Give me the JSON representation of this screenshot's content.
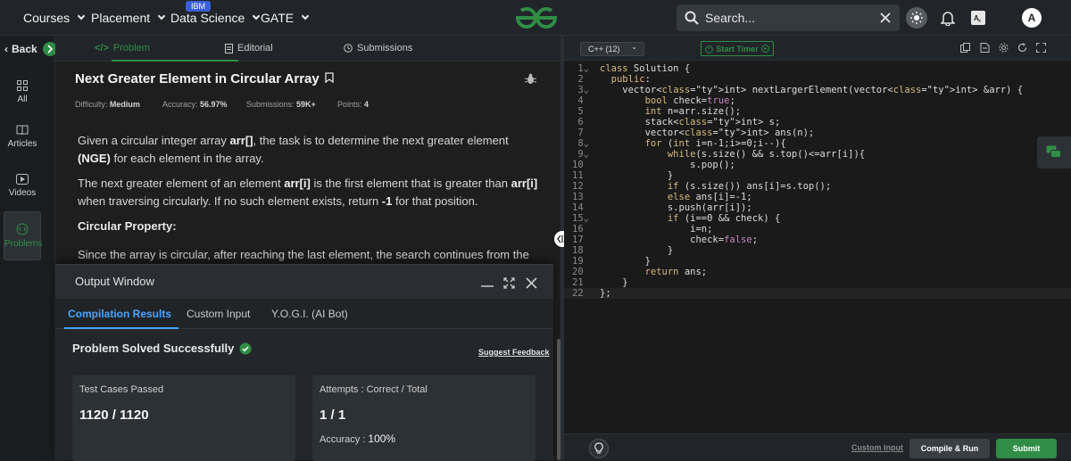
{
  "topnav": {
    "items": [
      {
        "label": "Courses"
      },
      {
        "label": "Placement"
      },
      {
        "label": "Data Science"
      },
      {
        "label": "GATE"
      }
    ],
    "ibm_badge": "IBM",
    "search_placeholder": "Search...",
    "avatar_letter": "A"
  },
  "sidebar": {
    "back_label": "Back",
    "items": [
      {
        "label": "All",
        "icon": "grid-icon"
      },
      {
        "label": "Articles",
        "icon": "book-icon"
      },
      {
        "label": "Videos",
        "icon": "play-icon"
      },
      {
        "label": "Problems",
        "icon": "code-icon"
      }
    ]
  },
  "problem_tabs": [
    {
      "label": "Problem",
      "icon": "code-icon"
    },
    {
      "label": "Editorial",
      "icon": "document-icon"
    },
    {
      "label": "Submissions",
      "icon": "clock-icon"
    }
  ],
  "problem": {
    "title": "Next Greater Element in Circular Array",
    "difficulty_label": "Difficulty:",
    "difficulty_value": "Medium",
    "accuracy_label": "Accuracy:",
    "accuracy_value": "56.97%",
    "submissions_label": "Submissions:",
    "submissions_value": "59K+",
    "points_label": "Points:",
    "points_value": "4",
    "p1_a": "Given a circular integer array ",
    "p1_b": "arr[]",
    "p1_c": ", the task is to determine the next greater element ",
    "p1_d": "(NGE)",
    "p1_e": " for each element in the array.",
    "p2_a": "The next greater element of an element ",
    "p2_b": "arr[i]",
    "p2_c": " is the first element that is greater than ",
    "p2_d": "arr[i]",
    "p2_e": " when traversing circularly. If no such element exists, return ",
    "p2_f": "-1",
    "p2_g": " for that position.",
    "subheading": "Circular Property:",
    "p3": "Since the array is circular, after reaching the last element, the search continues from the"
  },
  "output": {
    "title": "Output Window",
    "tabs": [
      "Compilation Results",
      "Custom Input",
      "Y.O.G.I. (AI Bot)"
    ],
    "status": "Problem Solved Successfully",
    "feedback_link": "Suggest Feedback",
    "card1_label": "Test Cases Passed",
    "card1_value": "1120 / 1120",
    "card2_label": "Attempts : Correct / Total",
    "card2_value": "1 / 1",
    "accuracy_label": "Accuracy : ",
    "accuracy_value": "100%"
  },
  "editor": {
    "language": "C++ (12)",
    "timer_label": "Start Timer",
    "custom_input": "Custom Input",
    "compile_label": "Compile & Run",
    "submit_label": "Submit",
    "lines": [
      "class Solution {",
      "  public:",
      "    vector<int> nextLargerElement(vector<int> &arr) {",
      "        bool check=true;",
      "        int n=arr.size();",
      "        stack<int> s;",
      "        vector<int> ans(n);",
      "        for (int i=n-1;i>=0;i--){",
      "            while(s.size() && s.top()<=arr[i]){",
      "                s.pop();",
      "            }",
      "            if (s.size()) ans[i]=s.top();",
      "            else ans[i]=-1;",
      "            s.push(arr[i]);",
      "            if (i==0 && check) {",
      "                i=n;",
      "                check=false;",
      "            }",
      "        }",
      "        return ans;",
      "    }",
      "};"
    ]
  },
  "colors": {
    "accent_green": "#2f8d46",
    "link_blue": "#4aa3ff"
  }
}
